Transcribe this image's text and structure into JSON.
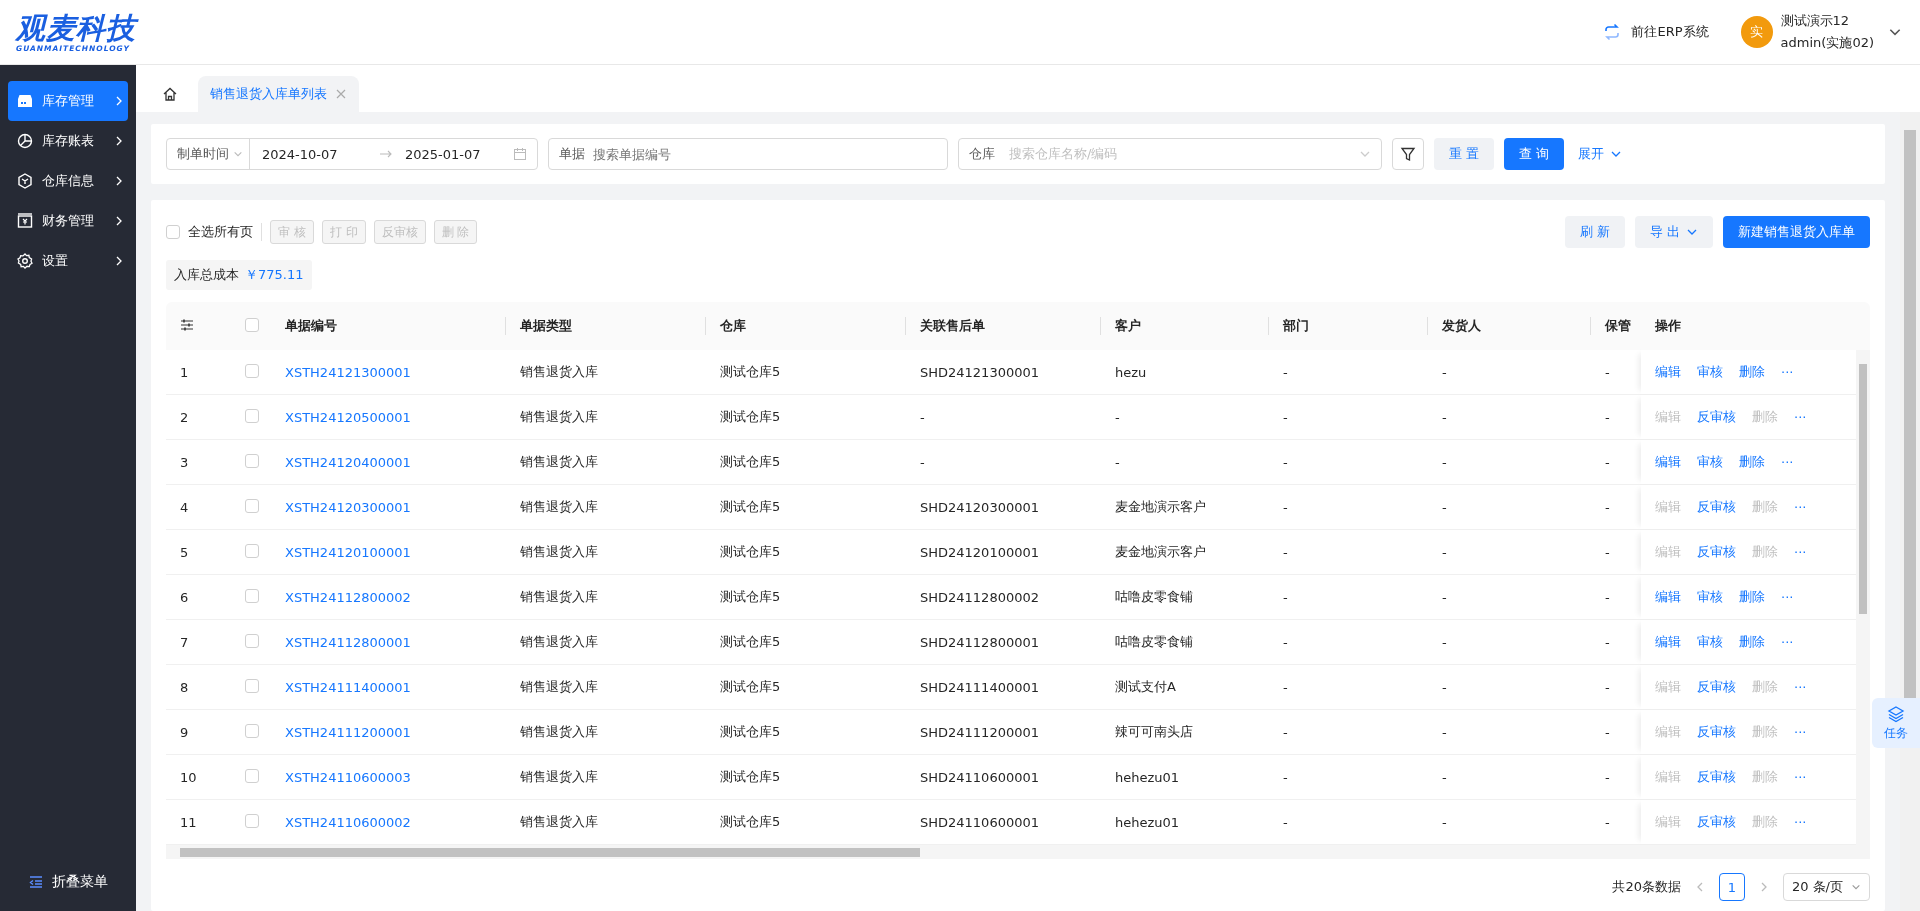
{
  "header": {
    "logo": "观麦科技",
    "logo_subtitle": "GUANMAITECHNOLOGY",
    "erp_link": "前往ERP系统",
    "user": {
      "avatar": "实",
      "name": "测试演示12",
      "account": "admin(实施02)"
    }
  },
  "sidebar": {
    "items": [
      {
        "label": "库存管理",
        "kind": "store",
        "selected": true
      },
      {
        "label": "库存账表",
        "kind": "chart",
        "selected": false
      },
      {
        "label": "仓库信息",
        "kind": "box",
        "selected": false
      },
      {
        "label": "财务管理",
        "kind": "cash",
        "selected": false
      },
      {
        "label": "设置",
        "kind": "gear",
        "selected": false
      }
    ],
    "collapse": "折叠菜单"
  },
  "tabs": [
    {
      "kind": "home",
      "selected": false
    },
    {
      "kind": "page",
      "label": "销售退货入库单列表",
      "selected": true
    }
  ],
  "filters": {
    "date_field": "制单时间",
    "start_date": "2024-10-07",
    "end_date": "2025-01-07",
    "doc_label": "单据",
    "doc_placeholder": "搜索单据编号",
    "warehouse_label": "仓库",
    "warehouse_placeholder": "搜索仓库名称/编码",
    "reset": "重 置",
    "query": "查 询",
    "expand": "展开"
  },
  "toolbar": {
    "select_all": {
      "label": "全选所有页",
      "checked": false
    },
    "batch_actions": [
      {
        "label": "审 核",
        "disabled": true
      },
      {
        "label": "打 印",
        "disabled": true
      },
      {
        "label": "反审核",
        "disabled": true
      },
      {
        "label": "删 除",
        "disabled": true
      }
    ],
    "refresh": "刷 新",
    "export": "导 出",
    "create": "新建销售退货入库单"
  },
  "total_cost": {
    "label": "入库总成本",
    "value": "￥775.11"
  },
  "table": {
    "header_checked": false,
    "columns": [
      "单据编号",
      "单据类型",
      "仓库",
      "关联售后单",
      "客户",
      "部门",
      "发货人",
      "保管",
      "操作"
    ],
    "rows": [
      {
        "no": "1",
        "checked": false,
        "code": "XSTH24121300001",
        "type": "销售退货入库",
        "warehouse": "测试仓库5",
        "order": "SHD24121300001",
        "customer": "hezu",
        "dept": "-",
        "shipper": "-",
        "keeper": "-",
        "actions": [
          {
            "label": "编辑",
            "disabled": false
          },
          {
            "label": "审核",
            "disabled": false
          },
          {
            "label": "删除",
            "disabled": false
          },
          {
            "label": "···",
            "disabled": false
          }
        ]
      },
      {
        "no": "2",
        "checked": false,
        "code": "XSTH24120500001",
        "type": "销售退货入库",
        "warehouse": "测试仓库5",
        "order": "-",
        "customer": "-",
        "dept": "-",
        "shipper": "-",
        "keeper": "-",
        "actions": [
          {
            "label": "编辑",
            "disabled": true
          },
          {
            "label": "反审核",
            "disabled": false
          },
          {
            "label": "删除",
            "disabled": true
          },
          {
            "label": "···",
            "disabled": false
          }
        ]
      },
      {
        "no": "3",
        "checked": false,
        "code": "XSTH24120400001",
        "type": "销售退货入库",
        "warehouse": "测试仓库5",
        "order": "-",
        "customer": "-",
        "dept": "-",
        "shipper": "-",
        "keeper": "-",
        "actions": [
          {
            "label": "编辑",
            "disabled": false
          },
          {
            "label": "审核",
            "disabled": false
          },
          {
            "label": "删除",
            "disabled": false
          },
          {
            "label": "···",
            "disabled": false
          }
        ]
      },
      {
        "no": "4",
        "checked": false,
        "code": "XSTH24120300001",
        "type": "销售退货入库",
        "warehouse": "测试仓库5",
        "order": "SHD24120300001",
        "customer": "麦金地演示客户",
        "dept": "-",
        "shipper": "-",
        "keeper": "-",
        "actions": [
          {
            "label": "编辑",
            "disabled": true
          },
          {
            "label": "反审核",
            "disabled": false
          },
          {
            "label": "删除",
            "disabled": true
          },
          {
            "label": "···",
            "disabled": false
          }
        ]
      },
      {
        "no": "5",
        "checked": false,
        "code": "XSTH24120100001",
        "type": "销售退货入库",
        "warehouse": "测试仓库5",
        "order": "SHD24120100001",
        "customer": "麦金地演示客户",
        "dept": "-",
        "shipper": "-",
        "keeper": "-",
        "actions": [
          {
            "label": "编辑",
            "disabled": true
          },
          {
            "label": "反审核",
            "disabled": false
          },
          {
            "label": "删除",
            "disabled": true
          },
          {
            "label": "···",
            "disabled": false
          }
        ]
      },
      {
        "no": "6",
        "checked": false,
        "code": "XSTH24112800002",
        "type": "销售退货入库",
        "warehouse": "测试仓库5",
        "order": "SHD24112800002",
        "customer": "咕噜皮零食铺",
        "dept": "-",
        "shipper": "-",
        "keeper": "-",
        "actions": [
          {
            "label": "编辑",
            "disabled": false
          },
          {
            "label": "审核",
            "disabled": false
          },
          {
            "label": "删除",
            "disabled": false
          },
          {
            "label": "···",
            "disabled": false
          }
        ]
      },
      {
        "no": "7",
        "checked": false,
        "code": "XSTH24112800001",
        "type": "销售退货入库",
        "warehouse": "测试仓库5",
        "order": "SHD24112800001",
        "customer": "咕噜皮零食铺",
        "dept": "-",
        "shipper": "-",
        "keeper": "-",
        "actions": [
          {
            "label": "编辑",
            "disabled": false
          },
          {
            "label": "审核",
            "disabled": false
          },
          {
            "label": "删除",
            "disabled": false
          },
          {
            "label": "···",
            "disabled": false
          }
        ]
      },
      {
        "no": "8",
        "checked": false,
        "code": "XSTH24111400001",
        "type": "销售退货入库",
        "warehouse": "测试仓库5",
        "order": "SHD24111400001",
        "customer": "测试支付A",
        "dept": "-",
        "shipper": "-",
        "keeper": "-",
        "actions": [
          {
            "label": "编辑",
            "disabled": true
          },
          {
            "label": "反审核",
            "disabled": false
          },
          {
            "label": "删除",
            "disabled": true
          },
          {
            "label": "···",
            "disabled": false
          }
        ]
      },
      {
        "no": "9",
        "checked": false,
        "code": "XSTH24111200001",
        "type": "销售退货入库",
        "warehouse": "测试仓库5",
        "order": "SHD24111200001",
        "customer": "辣可可南头店",
        "dept": "-",
        "shipper": "-",
        "keeper": "-",
        "actions": [
          {
            "label": "编辑",
            "disabled": true
          },
          {
            "label": "反审核",
            "disabled": false
          },
          {
            "label": "删除",
            "disabled": true
          },
          {
            "label": "···",
            "disabled": false
          }
        ]
      },
      {
        "no": "10",
        "checked": false,
        "code": "XSTH24110600003",
        "type": "销售退货入库",
        "warehouse": "测试仓库5",
        "order": "SHD24110600001",
        "customer": "hehezu01",
        "dept": "-",
        "shipper": "-",
        "keeper": "-",
        "actions": [
          {
            "label": "编辑",
            "disabled": true
          },
          {
            "label": "反审核",
            "disabled": false
          },
          {
            "label": "删除",
            "disabled": true
          },
          {
            "label": "···",
            "disabled": false
          }
        ]
      },
      {
        "no": "11",
        "checked": false,
        "code": "XSTH24110600002",
        "type": "销售退货入库",
        "warehouse": "测试仓库5",
        "order": "SHD24110600001",
        "customer": "hehezu01",
        "dept": "-",
        "shipper": "-",
        "keeper": "-",
        "actions": [
          {
            "label": "编辑",
            "disabled": true
          },
          {
            "label": "反审核",
            "disabled": false
          },
          {
            "label": "删除",
            "disabled": true
          },
          {
            "label": "···",
            "disabled": false
          }
        ]
      }
    ]
  },
  "pagination": {
    "total": "共20条数据",
    "pages": [
      {
        "label": "1",
        "selected": true
      }
    ],
    "page_size": "20 条/页"
  },
  "task_button": "任务"
}
